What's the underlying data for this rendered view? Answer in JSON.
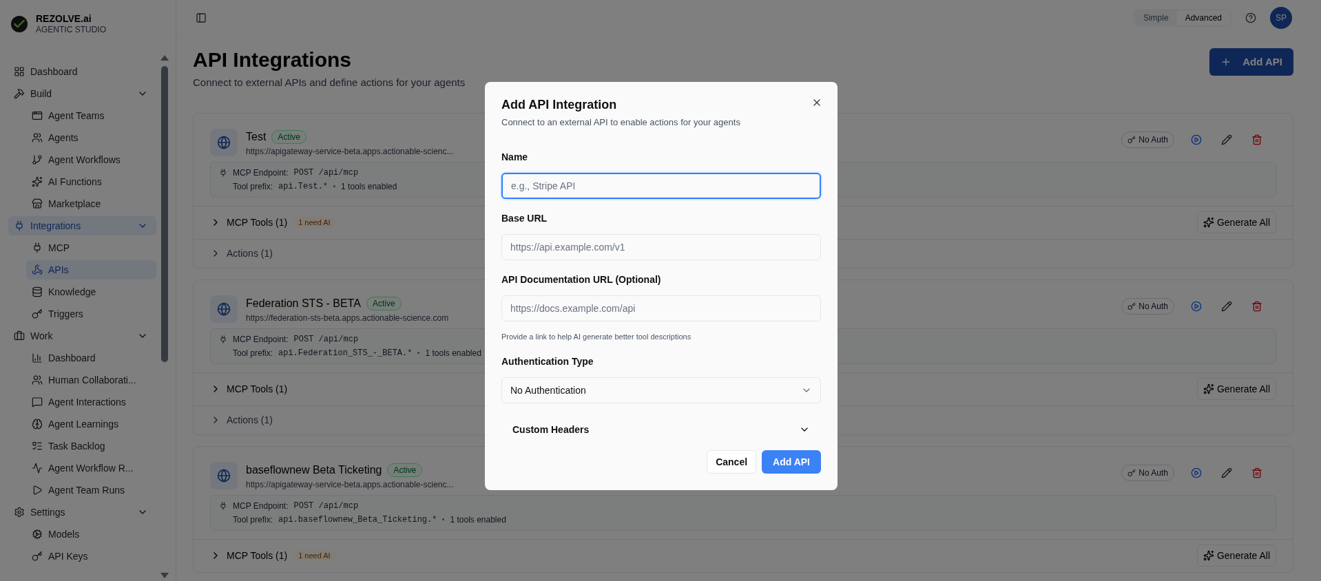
{
  "brand": {
    "name": "REZOLVE.ai",
    "subtitle": "AGENTIC STUDIO"
  },
  "sidebar": {
    "items": [
      {
        "label": "Dashboard",
        "selected": false
      },
      {
        "label": "Build",
        "selected": false,
        "expanded": true,
        "children": [
          {
            "label": "Agent Teams",
            "selected": false
          },
          {
            "label": "Agents",
            "selected": false
          },
          {
            "label": "Agent Workflows",
            "selected": false
          },
          {
            "label": "AI Functions",
            "selected": false
          },
          {
            "label": "Marketplace",
            "selected": false
          }
        ]
      },
      {
        "label": "Integrations",
        "selected": true,
        "expanded": true,
        "children": [
          {
            "label": "MCP",
            "selected": false
          },
          {
            "label": "APIs",
            "selected": true
          },
          {
            "label": "Knowledge",
            "selected": false
          },
          {
            "label": "Triggers",
            "selected": false
          }
        ]
      },
      {
        "label": "Work",
        "selected": false,
        "expanded": true,
        "children": [
          {
            "label": "Dashboard",
            "selected": false
          },
          {
            "label": "Human Collaborati...",
            "selected": false
          },
          {
            "label": "Agent Interactions",
            "selected": false
          },
          {
            "label": "Agent Learnings",
            "selected": false
          },
          {
            "label": "Task Backlog",
            "selected": false
          },
          {
            "label": "Agent Workflow R...",
            "selected": false
          },
          {
            "label": "Agent Team Runs",
            "selected": false
          }
        ]
      },
      {
        "label": "Settings",
        "selected": false,
        "expanded": true,
        "children": [
          {
            "label": "Models",
            "selected": false
          },
          {
            "label": "API Keys",
            "selected": false
          }
        ]
      }
    ]
  },
  "header": {
    "modes": [
      {
        "label": "Simple",
        "selected": false
      },
      {
        "label": "Advanced",
        "selected": true
      }
    ],
    "avatar": "SP"
  },
  "page": {
    "title": "API Integrations",
    "subtitle": "Connect to external APIs and define actions for your agents",
    "add_button": "Add API"
  },
  "integrations": [
    {
      "name": "Test",
      "status": "Active",
      "url": "https://apigateway-service-beta.apps.actionable-scienc...",
      "endpoint_label": "MCP Endpoint:",
      "endpoint": "POST /api/mcp",
      "prefix_label": "Tool prefix:",
      "prefix": "api.Test.*",
      "tools_enabled": "1 tools enabled",
      "auth": "No Auth",
      "generate_button": "Generate All",
      "sections": [
        {
          "label": "MCP Tools (1)",
          "badge": "1 need AI",
          "primary": true
        },
        {
          "label": "Actions (1)",
          "primary": false
        }
      ]
    },
    {
      "name": "Federation STS - BETA",
      "status": "Active",
      "url": "https://federation-sts-beta.apps.actionable-science.com",
      "endpoint_label": "MCP Endpoint:",
      "endpoint": "POST /api/mcp",
      "prefix_label": "Tool prefix:",
      "prefix": "api.Federation_STS_-_BETA.*",
      "tools_enabled": "1 tools enabled",
      "auth": "No Auth",
      "generate_button": "Generate All",
      "sections": [
        {
          "label": "MCP Tools (1)",
          "primary": true
        },
        {
          "label": "Actions (1)",
          "primary": false
        }
      ]
    },
    {
      "name": "baseflownew Beta Ticketing",
      "status": "Active",
      "url": "https://apigateway-service-beta.apps.actionable-scienc...",
      "endpoint_label": "MCP Endpoint:",
      "endpoint": "POST /api/mcp",
      "prefix_label": "Tool prefix:",
      "prefix": "api.baseflownew_Beta_Ticketing.*",
      "tools_enabled": "1 tools enabled",
      "auth": "No Auth",
      "generate_button": "Generate All",
      "sections": [
        {
          "label": "MCP Tools (1)",
          "badge": "1 need AI",
          "primary": true
        }
      ]
    }
  ],
  "dialog": {
    "title": "Add API Integration",
    "description": "Connect to an external API to enable actions for your agents",
    "fields": [
      {
        "label": "Name",
        "placeholder": "e.g., Stripe API",
        "focused": true
      },
      {
        "label": "Base URL",
        "placeholder": "https://api.example.com/v1",
        "focused": false
      },
      {
        "label": "API Documentation URL (Optional)",
        "placeholder": "https://docs.example.com/api",
        "focused": false,
        "hint": "Provide a link to help AI generate better tool descriptions"
      }
    ],
    "auth": {
      "label": "Authentication Type",
      "value": "No Authentication"
    },
    "custom_headers": {
      "label": "Custom Headers",
      "expanded": false
    },
    "cancel": "Cancel",
    "submit": "Add API"
  }
}
